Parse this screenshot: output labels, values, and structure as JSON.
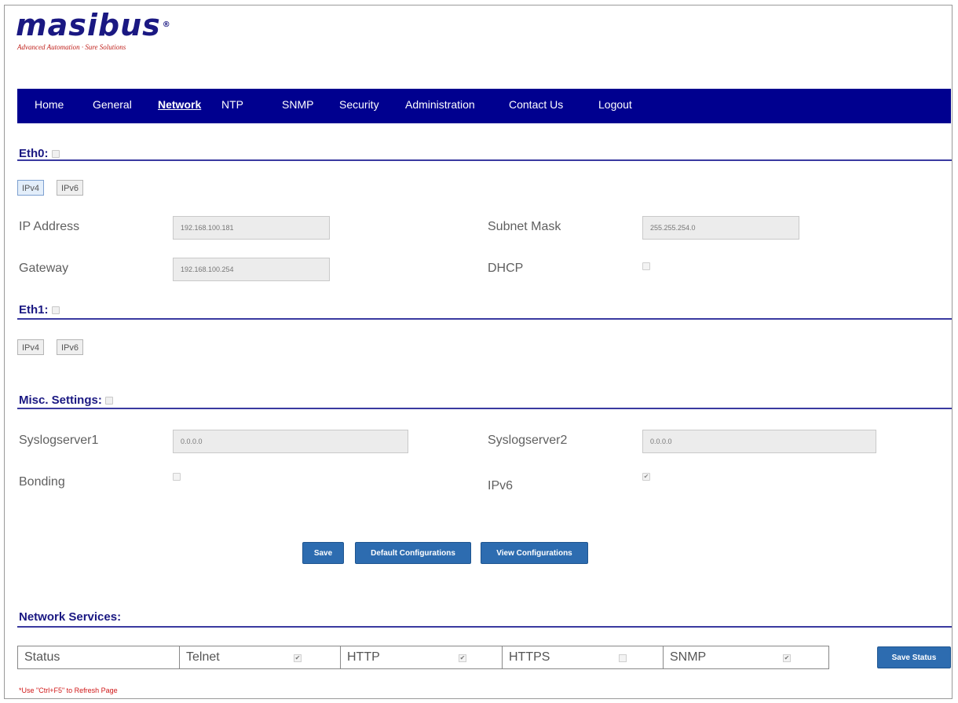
{
  "brand": {
    "logo": "masibus",
    "registered": "®",
    "tagline": "Advanced Automation · Sure Solutions"
  },
  "nav": {
    "items": [
      {
        "label": "Home",
        "active": false
      },
      {
        "label": "General",
        "active": false
      },
      {
        "label": "Network",
        "active": true
      },
      {
        "label": "NTP",
        "active": false
      },
      {
        "label": "SNMP",
        "active": false
      },
      {
        "label": "Security",
        "active": false
      },
      {
        "label": "Administration",
        "active": false
      },
      {
        "label": "Contact Us",
        "active": false
      },
      {
        "label": "Logout",
        "active": false
      }
    ]
  },
  "eth0": {
    "title": "Eth0:",
    "tabs": [
      "IPv4",
      "IPv6"
    ],
    "ip_label": "IP Address",
    "ip_value": "192.168.100.181",
    "subnet_label": "Subnet Mask",
    "subnet_value": "255.255.254.0",
    "gateway_label": "Gateway",
    "gateway_value": "192.168.100.254",
    "dhcp_label": "DHCP",
    "dhcp_checked": false
  },
  "eth1": {
    "title": "Eth1:",
    "tabs": [
      "IPv4",
      "IPv6"
    ]
  },
  "misc": {
    "title": "Misc. Settings:",
    "syslog1_label": "Syslogserver1",
    "syslog1_value": "0.0.0.0",
    "syslog2_label": "Syslogserver2",
    "syslog2_value": "0.0.0.0",
    "bonding_label": "Bonding",
    "bonding_checked": false,
    "ipv6_label": "IPv6",
    "ipv6_checked": true
  },
  "actions": {
    "save": "Save",
    "default_configurations": "Default Configurations",
    "view_configurations": "View Configurations"
  },
  "services": {
    "title": "Network Services:",
    "status_label": "Status",
    "telnet_label": "Telnet",
    "telnet_checked": true,
    "http_label": "HTTP",
    "http_checked": true,
    "https_label": "HTTPS",
    "https_checked": false,
    "snmp_label": "SNMP",
    "snmp_checked": true,
    "save_status": "Save Status"
  },
  "footer": {
    "note": "*Use \"Ctrl+F5\" to Refresh Page"
  },
  "colors": {
    "nav_bg": "#00008f",
    "brand": "#1a1882",
    "button": "#2d6cb0",
    "note": "#d01818"
  }
}
